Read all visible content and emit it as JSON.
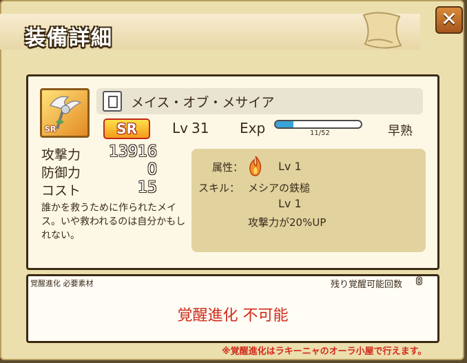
{
  "window": {
    "title": "装備詳細",
    "close_label": "✕"
  },
  "item": {
    "name": "メイス・オブ・メサイア",
    "rarity": "SR",
    "icon_rarity": "SR",
    "level_label": "Lv",
    "level": "31",
    "exp_label": "Exp",
    "exp_text": "11/52",
    "exp_fraction": 0.21,
    "growth_type": "早熟",
    "description": "誰かを救うために作られたメイス。いや救われるのは自分かもしれない。"
  },
  "stats": [
    {
      "label": "攻撃力",
      "value": "13916"
    },
    {
      "label": "防御力",
      "value": "0"
    },
    {
      "label": "コスト",
      "value": "15"
    }
  ],
  "skill": {
    "attribute_label": "属性：",
    "attribute_icon": "fire-icon",
    "attribute_lv": "Lv 1",
    "skill_label": "スキル：",
    "skill_name": "メシアの鉄槌",
    "skill_lv": "Lv 1",
    "effect": "攻撃力が20%UP"
  },
  "awakening": {
    "materials_label": "覚醒進化 必要素材",
    "remaining_label": "残り覚醒可能回数",
    "remaining_count": "0",
    "status": "覚醒進化 不可能",
    "note": "※覚醒進化はラキーニャのオーラ小屋で行えます。"
  },
  "colors": {
    "accent_red": "#d02a1a",
    "exp_fill": "#3aa3d8",
    "frame_bg": "#ecdfae"
  }
}
